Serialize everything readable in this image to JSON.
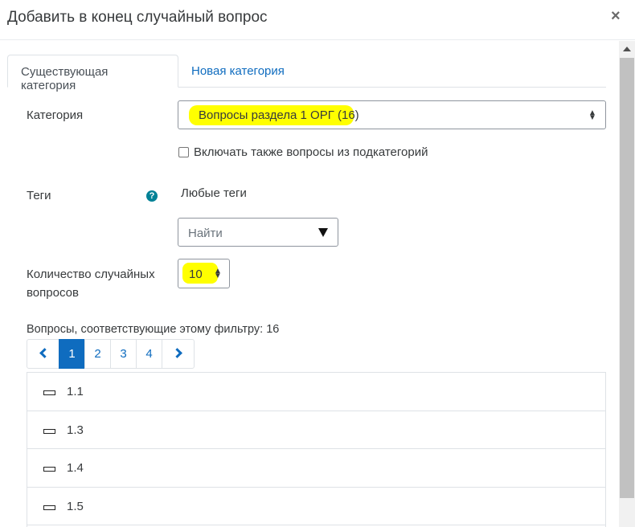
{
  "dialog": {
    "title": "Добавить в конец случайный вопрос",
    "close_glyph": "×"
  },
  "tabs": [
    {
      "label": "Существующая категория",
      "active": true
    },
    {
      "label": "Новая категория",
      "active": false
    }
  ],
  "form": {
    "category_label": "Категория",
    "category_value": "Вопросы раздела 1 ОРГ (16)",
    "subcategories_label": "Включать также вопросы из подкатегорий",
    "subcategories_checked": false,
    "tags_label": "Теги",
    "tags_help_icon": "question-circle-icon",
    "tags_value": "Любые теги",
    "tags_search_placeholder": "Найти",
    "count_label_line1": "Количество случайных",
    "count_label_line2": "вопросов",
    "count_value": "10",
    "highlight_color": "#ffff00"
  },
  "filter": {
    "matching_text": "Вопросы, соответствующие этому фильтру: 16"
  },
  "pagination": {
    "pages": [
      "1",
      "2",
      "3",
      "4"
    ],
    "current": "1"
  },
  "questions": [
    {
      "name": "1.1",
      "icon": "true-false-question-icon"
    },
    {
      "name": "1.3",
      "icon": "true-false-question-icon"
    },
    {
      "name": "1.4",
      "icon": "true-false-question-icon"
    },
    {
      "name": "1.5",
      "icon": "true-false-question-icon"
    }
  ],
  "colors": {
    "link": "#0f6cbf",
    "help": "#008196"
  }
}
